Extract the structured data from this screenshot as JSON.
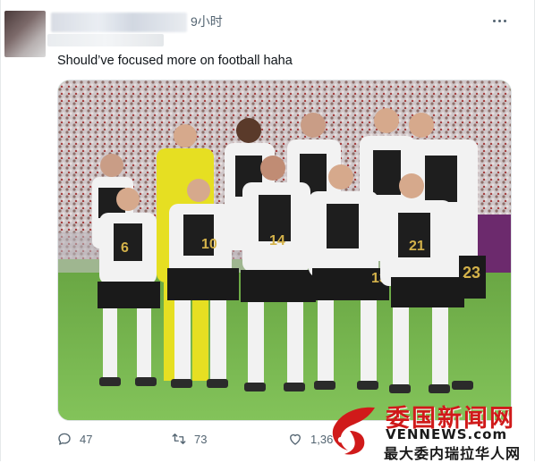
{
  "tweet": {
    "time": "9小时",
    "text": "Should’ve focused more on football haha"
  },
  "photo": {
    "jersey_numbers": [
      "6",
      "10",
      "14",
      "13",
      "21",
      "23"
    ]
  },
  "actions": {
    "replies": "47",
    "retweets": "73",
    "likes": "1,36"
  },
  "watermark": {
    "title": "委国新闻网",
    "subtitle_1": "VENNEWS.com",
    "subtitle_2": "最大委内瑞拉华人网"
  },
  "colors": {
    "text": "#0f1419",
    "muted": "#536471",
    "watermark_red": "#d01a1a"
  }
}
